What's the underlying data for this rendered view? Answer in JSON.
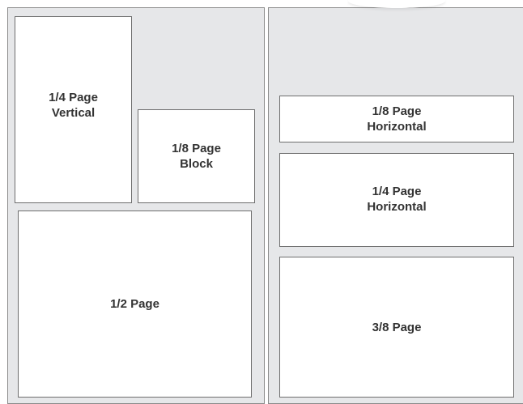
{
  "left_page": {
    "quarter_vertical": "1/4 Page\nVertical",
    "eighth_block": "1/8 Page\nBlock",
    "half_page": "1/2 Page"
  },
  "right_page": {
    "eighth_horizontal": "1/8 Page\nHorizontal",
    "quarter_horizontal": "1/4 Page\nHorizontal",
    "three_eighths": "3/8 Page"
  }
}
